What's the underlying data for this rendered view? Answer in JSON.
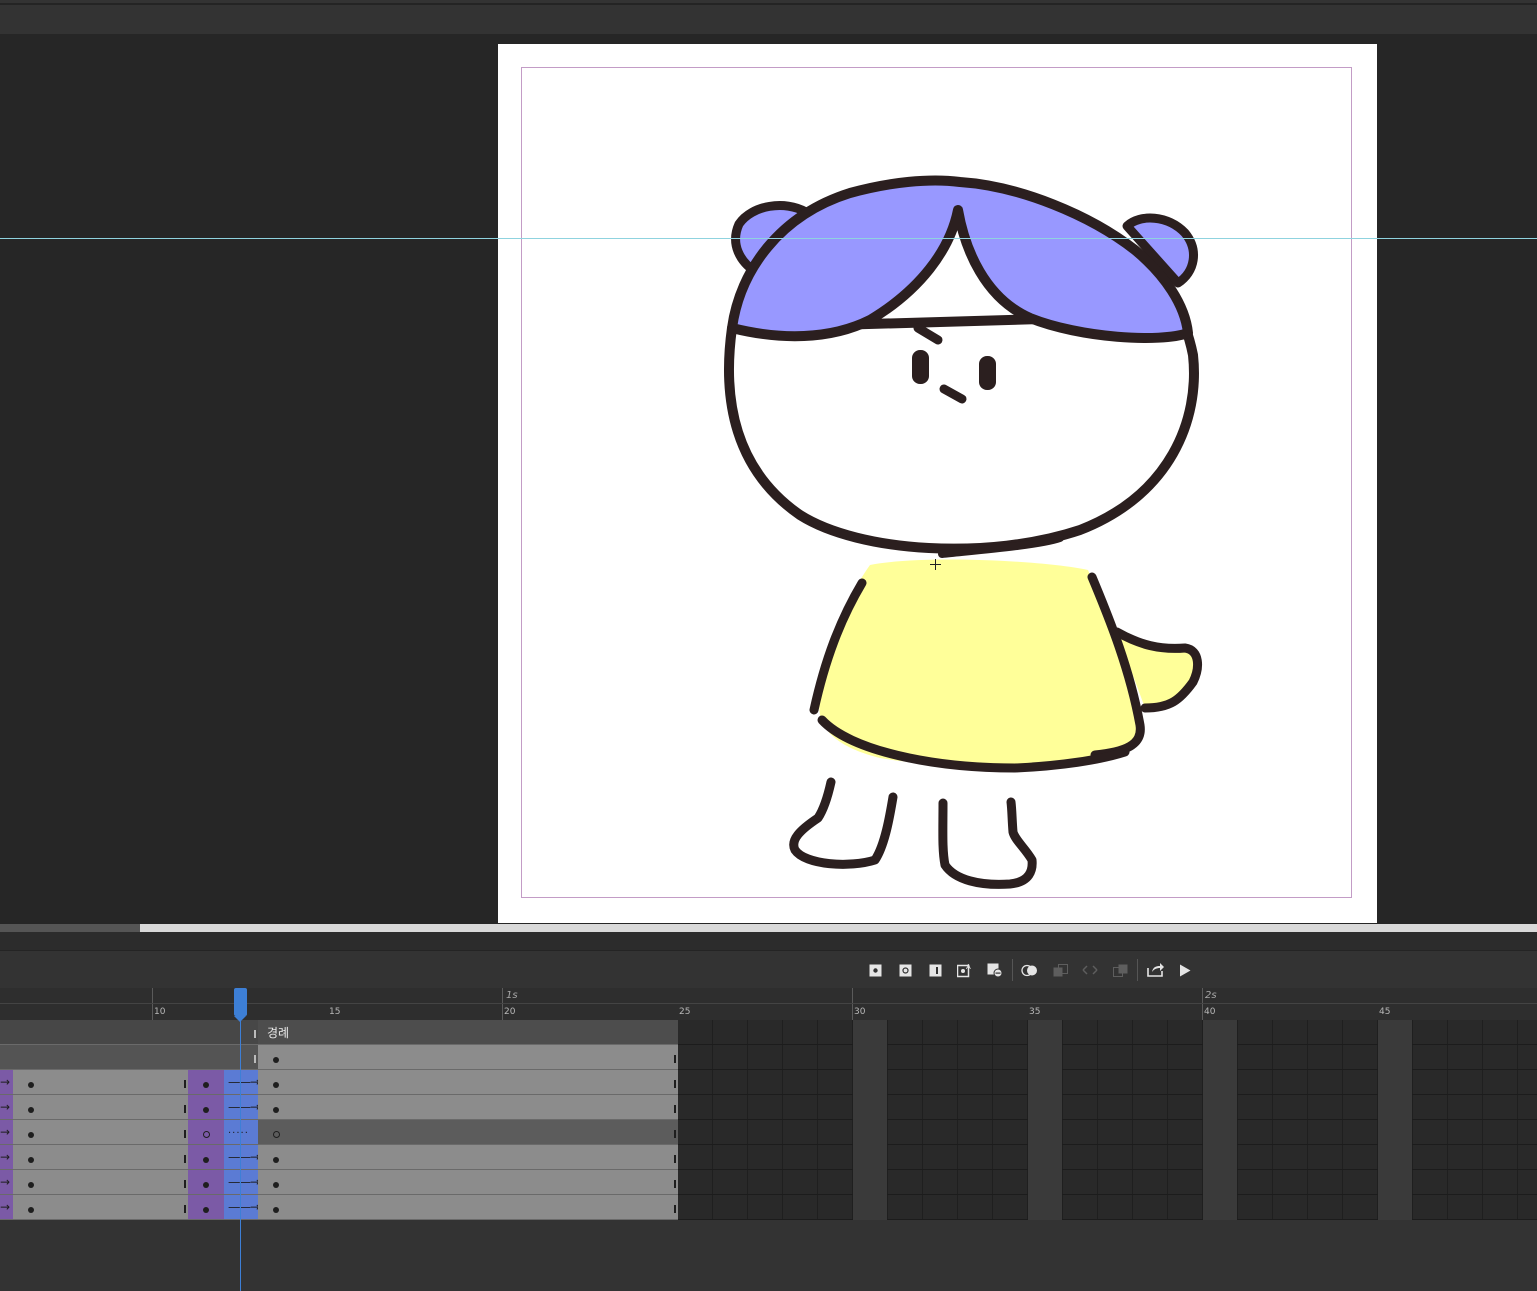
{
  "timeline": {
    "layer_label": "경례",
    "second_markers": [
      "1s",
      "2s"
    ],
    "frame_numbers": [
      "10",
      "15",
      "20",
      "25",
      "30",
      "35",
      "40",
      "45"
    ],
    "toolbar_icons": [
      "insert-keyframe-icon",
      "insert-blank-keyframe-icon",
      "insert-frame-icon",
      "auto-keyframe-icon",
      "remove-frame-icon",
      "onion-skin-icon",
      "onion-skin-outline-icon",
      "edit-multiple-frames-icon",
      "loop-icon",
      "export-icon",
      "play-icon"
    ],
    "disabled_icons": [
      "onion-skin-outline-icon",
      "edit-multiple-frames-icon",
      "loop-icon"
    ]
  },
  "colors": {
    "hair": "#9898ff",
    "shirt": "#ffff99",
    "outline": "#2b1f1f",
    "tween_purple": "#7b5aa6",
    "tween_blue": "#5b7bd4",
    "playhead": "#3d7fd6"
  }
}
